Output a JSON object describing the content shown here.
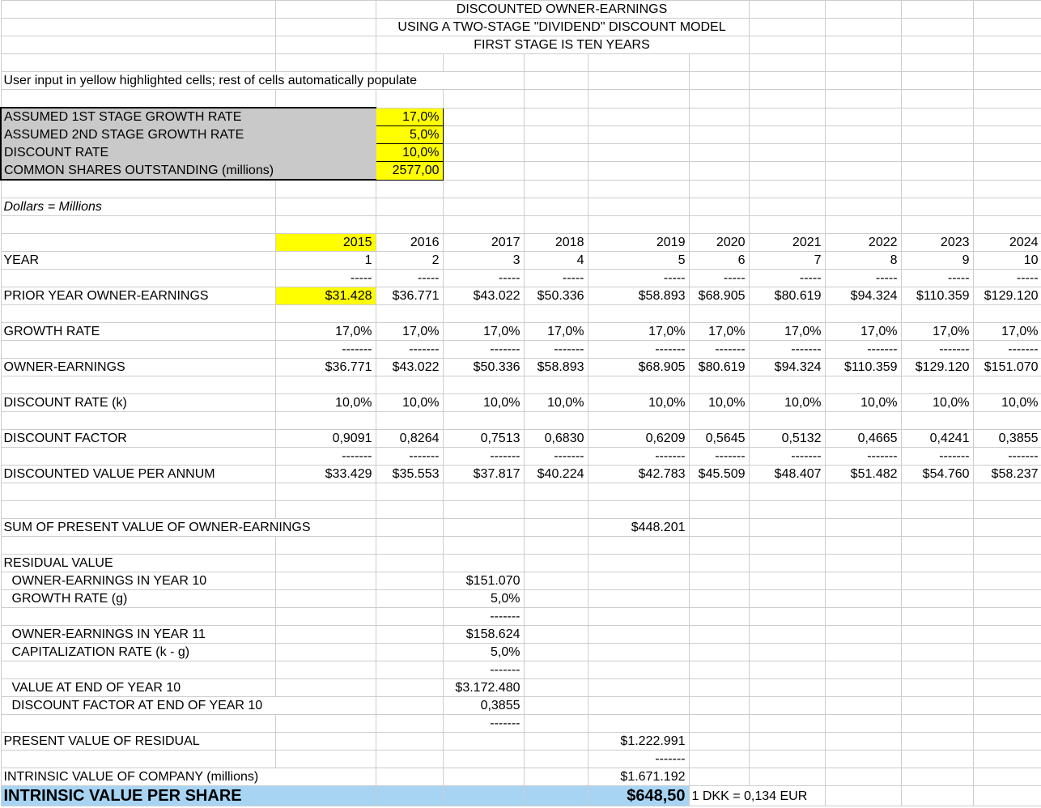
{
  "title": {
    "line1": "DISCOUNTED OWNER-EARNINGS",
    "line2": "USING A TWO-STAGE \"DIVIDEND\" DISCOUNT MODEL",
    "line3": "FIRST STAGE IS TEN YEARS"
  },
  "note": "User input in yellow highlighted cells; rest of cells automatically populate",
  "units_note": "Dollars = Millions",
  "inputs": [
    {
      "label": "ASSUMED 1ST STAGE GROWTH RATE",
      "value": "17,0%"
    },
    {
      "label": "ASSUMED 2ND STAGE GROWTH RATE",
      "value": "5,0%"
    },
    {
      "label": "DISCOUNT RATE",
      "value": "10,0%"
    },
    {
      "label": "COMMON SHARES OUTSTANDING (millions)",
      "value": "2577,00"
    }
  ],
  "dashes": {
    "short": "-----",
    "long": "-------"
  },
  "model": {
    "years": [
      "2015",
      "2016",
      "2017",
      "2018",
      "2019",
      "2020",
      "2021",
      "2022",
      "2023",
      "2024"
    ],
    "year_row_label": "YEAR",
    "year_numbers": [
      "1",
      "2",
      "3",
      "4",
      "5",
      "6",
      "7",
      "8",
      "9",
      "10"
    ],
    "prior_label": "PRIOR YEAR OWNER-EARNINGS",
    "prior": [
      "$31.428",
      "$36.771",
      "$43.022",
      "$50.336",
      "$58.893",
      "$68.905",
      "$80.619",
      "$94.324",
      "$110.359",
      "$129.120"
    ],
    "growth_label": "GROWTH RATE",
    "growth": [
      "17,0%",
      "17,0%",
      "17,0%",
      "17,0%",
      "17,0%",
      "17,0%",
      "17,0%",
      "17,0%",
      "17,0%",
      "17,0%"
    ],
    "oe_label": "OWNER-EARNINGS",
    "oe": [
      "$36.771",
      "$43.022",
      "$50.336",
      "$58.893",
      "$68.905",
      "$80.619",
      "$94.324",
      "$110.359",
      "$129.120",
      "$151.070"
    ],
    "dr_label": "DISCOUNT RATE (k)",
    "dr": [
      "10,0%",
      "10,0%",
      "10,0%",
      "10,0%",
      "10,0%",
      "10,0%",
      "10,0%",
      "10,0%",
      "10,0%",
      "10,0%"
    ],
    "df_label": "DISCOUNT FACTOR",
    "df": [
      "0,9091",
      "0,8264",
      "0,7513",
      "0,6830",
      "0,6209",
      "0,5645",
      "0,5132",
      "0,4665",
      "0,4241",
      "0,3855"
    ],
    "dv_label": "DISCOUNTED VALUE PER ANNUM",
    "dv": [
      "$33.429",
      "$35.553",
      "$37.817",
      "$40.224",
      "$42.783",
      "$45.509",
      "$48.407",
      "$51.482",
      "$54.760",
      "$58.237"
    ]
  },
  "summary": {
    "sum_pv_label": "SUM OF PRESENT VALUE OF OWNER-EARNINGS",
    "sum_pv_value": "$448.201",
    "residual_header": "RESIDUAL VALUE",
    "oe_y10_label": "OWNER-EARNINGS IN YEAR 10",
    "oe_y10_value": "$151.070",
    "growth_g_label": "GROWTH RATE (g)",
    "growth_g_value": "5,0%",
    "oe_y11_label": "OWNER-EARNINGS IN YEAR 11",
    "oe_y11_value": "$158.624",
    "cap_rate_label": "CAPITALIZATION RATE (k - g)",
    "cap_rate_value": "5,0%",
    "value_end_y10_label": "VALUE AT END OF YEAR 10",
    "value_end_y10_value": "$3.172.480",
    "df_end_y10_label": "DISCOUNT FACTOR AT END OF YEAR 10",
    "df_end_y10_value": "0,3855",
    "pv_residual_label": "PRESENT VALUE OF RESIDUAL",
    "pv_residual_value": "$1.222.991",
    "intrinsic_company_label": "INTRINSIC VALUE OF COMPANY (millions)",
    "intrinsic_company_value": "$1.671.192",
    "intrinsic_share_label": "INTRINSIC VALUE PER SHARE",
    "intrinsic_share_value": "$648,50",
    "fx_note": "1 DKK = 0,134 EUR"
  },
  "colors": {
    "input_highlight": "#ffff00",
    "input_block_bg": "#c9c9c9",
    "result_highlight": "#a8d4f4",
    "gridline": "#cdcdcd"
  }
}
